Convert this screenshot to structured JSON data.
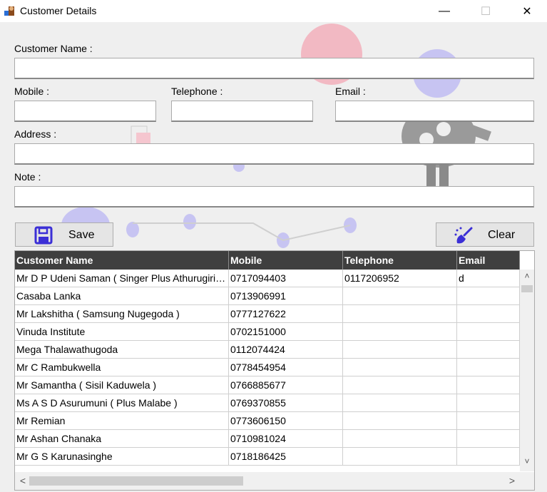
{
  "window": {
    "title": "Customer Details",
    "minimize_glyph": "—",
    "maximize_glyph": "☐",
    "close_glyph": "✕"
  },
  "form": {
    "customer_name_label": "Customer Name :",
    "customer_name_value": "",
    "mobile_label": "Mobile :",
    "mobile_value": "",
    "telephone_label": "Telephone :",
    "telephone_value": "",
    "email_label": "Email :",
    "email_value": "",
    "address_label": "Address :",
    "address_value": "",
    "note_label": "Note :",
    "note_value": ""
  },
  "buttons": {
    "save_label": "Save",
    "clear_label": "Clear",
    "save_icon": "floppy-disk-icon",
    "clear_icon": "broom-icon"
  },
  "grid": {
    "columns": [
      "Customer Name",
      "Mobile",
      "Telephone",
      "Email"
    ],
    "rows": [
      [
        "Mr D P Udeni Saman ( Singer Plus Athurugiriya )",
        "0717094403",
        "0117206952",
        "d"
      ],
      [
        "Casaba Lanka",
        "0713906991",
        "",
        ""
      ],
      [
        "Mr Lakshitha ( Samsung Nugegoda )",
        "0777127622",
        "",
        ""
      ],
      [
        "Vinuda Institute",
        "0702151000",
        "",
        ""
      ],
      [
        "Mega Thalawathugoda",
        "0112074424",
        "",
        ""
      ],
      [
        "Mr C Rambukwella",
        "0778454954",
        "",
        ""
      ],
      [
        "Mr Samantha ( Sisil Kaduwela )",
        "0766885677",
        "",
        ""
      ],
      [
        "Ms A S D Asurumuni ( Plus Malabe )",
        "0769370855",
        "",
        ""
      ],
      [
        "Mr Remian",
        "0773606150",
        "",
        ""
      ],
      [
        "Mr Ashan Chanaka",
        "0710981024",
        "",
        ""
      ],
      [
        "Mr G S Karunasinghe",
        "0718186425",
        "",
        ""
      ]
    ],
    "scroll_up": "˄",
    "scroll_down": "˅",
    "scroll_left": "<",
    "scroll_right": ">"
  },
  "colors": {
    "header_bg": "#3f3f3f",
    "accent_icon": "#3b2fd6",
    "background": "#efefef"
  }
}
